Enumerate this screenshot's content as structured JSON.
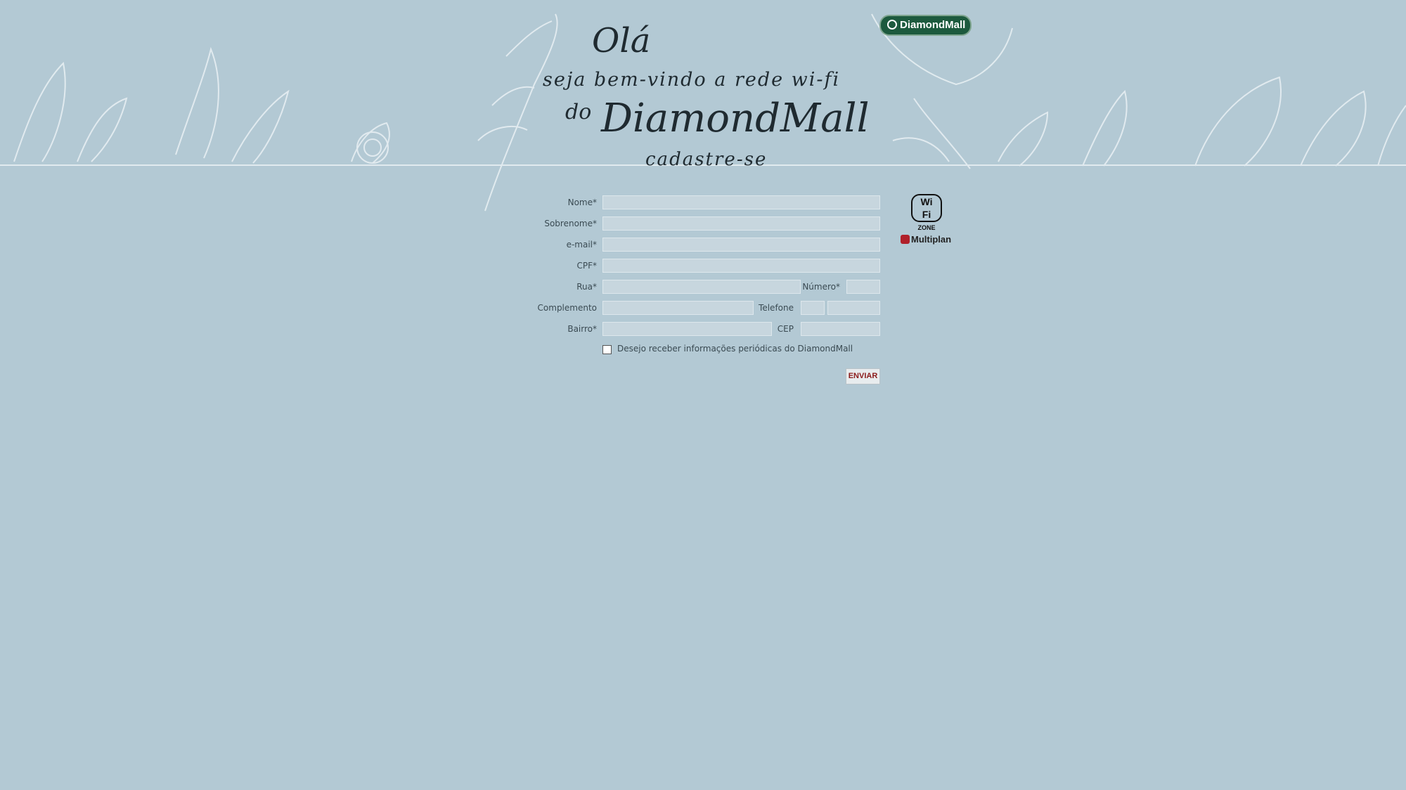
{
  "header": {
    "logo_text": "DiamondMall",
    "greeting": "Olá",
    "line1": "seja bem-vindo a rede wi-fi",
    "line2_prefix": "do",
    "line2_brand": "DiamondMall",
    "cta": "cadastre-se"
  },
  "form": {
    "nome_label": "Nome*",
    "sobrenome_label": "Sobrenome*",
    "email_label": "e-mail*",
    "cpf_label": "CPF*",
    "rua_label": "Rua*",
    "numero_label": "Número*",
    "complemento_label": "Complemento",
    "telefone_label": "Telefone",
    "bairro_label": "Bairro*",
    "cep_label": "CEP",
    "newsletter_label": "Desejo receber informações periódicas do DiamondMall",
    "newsletter_checked": false,
    "submit_label": "ENVIAR"
  },
  "side": {
    "wifi_text": "Wi Fi",
    "wifi_zone": "ZONE",
    "partner": "Multiplan"
  },
  "colors": {
    "background": "#b3c9d4",
    "brand_green": "#1d5a3e",
    "button_text": "#8a1a1a"
  }
}
